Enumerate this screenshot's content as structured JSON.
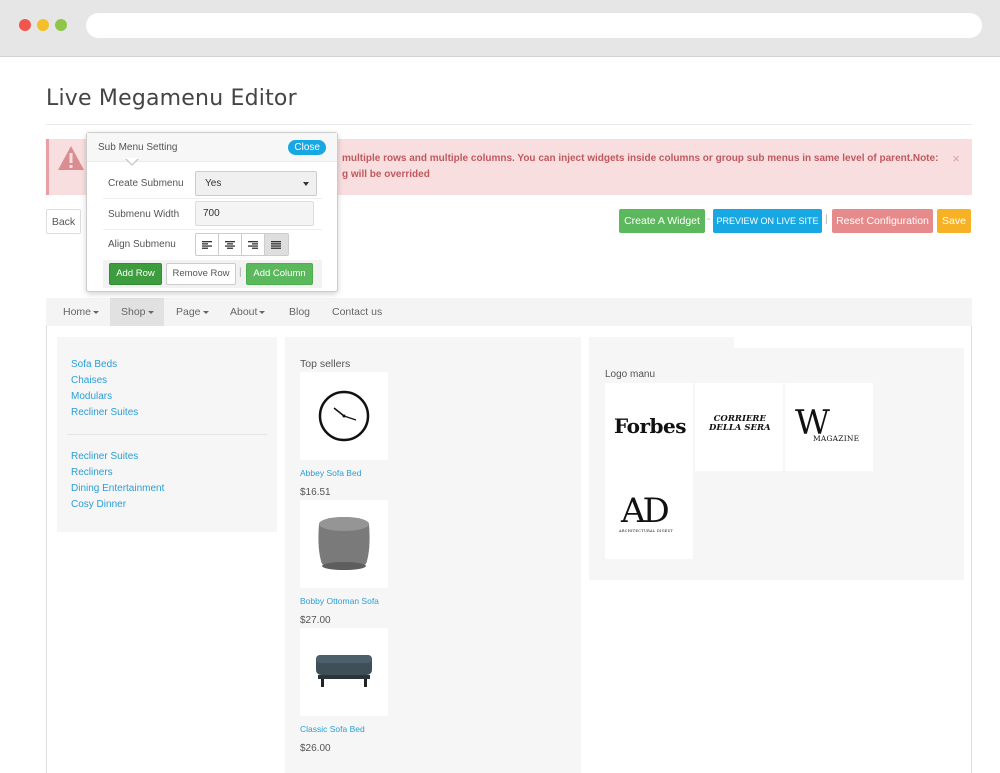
{
  "page": {
    "title": "Live Megamenu Editor"
  },
  "alert": {
    "line1": "multiple rows and multiple columns. You can inject widgets inside columns or group sub menus in same level of parent.Note:",
    "line2": "g will be overrided",
    "close": "×"
  },
  "toolbar": {
    "back": "Back",
    "create_widget": "Create A Widget",
    "separator_dash": "-",
    "preview": "PREVIEW ON LIVE SITE",
    "separator_bar": "|",
    "reset": "Reset Configuration",
    "save": "Save"
  },
  "nav": {
    "items": [
      {
        "label": "Home",
        "dropdown": true
      },
      {
        "label": "Shop",
        "dropdown": true,
        "active": true
      },
      {
        "label": "Page",
        "dropdown": true
      },
      {
        "label": "About",
        "dropdown": true
      },
      {
        "label": "Blog",
        "dropdown": false
      },
      {
        "label": "Contact us",
        "dropdown": false
      }
    ]
  },
  "megamenu": {
    "group1": [
      "Sofa Beds",
      "Chaises",
      "Modulars",
      "Recliner Suites"
    ],
    "group2": [
      "Recliner Suites",
      "Recliners",
      "Dining Entertainment",
      "Cosy Dinner"
    ],
    "top_sellers": {
      "heading": "Top sellers",
      "products": [
        {
          "name": "Abbey Sofa Bed",
          "price": "$16.51",
          "image": "wall-clock"
        },
        {
          "name": "Bobby Ottoman Sofa",
          "price": "$27.00",
          "image": "pouf-ottoman"
        },
        {
          "name": "Classic Sofa Bed",
          "price": "$26.00",
          "image": "footstool"
        }
      ]
    },
    "logos": {
      "heading": "Logo manu",
      "items": [
        {
          "name": "Forbes",
          "text": "Forbes"
        },
        {
          "name": "Corriere della Sera",
          "line1": "CORRIERE",
          "line2": "DELLA SERA"
        },
        {
          "name": "W Magazine",
          "letter": "W",
          "text": "MAGAZINE"
        },
        {
          "name": "Architectural Digest",
          "letters": "AD",
          "text": "ARCHITECTURAL DIGEST"
        }
      ]
    }
  },
  "popover": {
    "title": "Sub Menu Setting",
    "close": "Close",
    "create_submenu_label": "Create Submenu",
    "create_submenu_value": "Yes",
    "width_label": "Submenu Width",
    "width_value": "700",
    "align_label": "Align Submenu",
    "align_options": [
      "align-left-icon",
      "align-center-icon",
      "align-right-icon",
      "align-justify-icon"
    ],
    "add_row": "Add Row",
    "remove_row": "Remove Row",
    "separator": "|",
    "add_column": "Add Column"
  },
  "colors": {
    "accent_blue": "#17a8e3",
    "green": "#5cb85c",
    "danger_bg": "#f8dedf",
    "reset": "#e78a8c",
    "save": "#f7b125",
    "link": "#2a9fd6"
  }
}
